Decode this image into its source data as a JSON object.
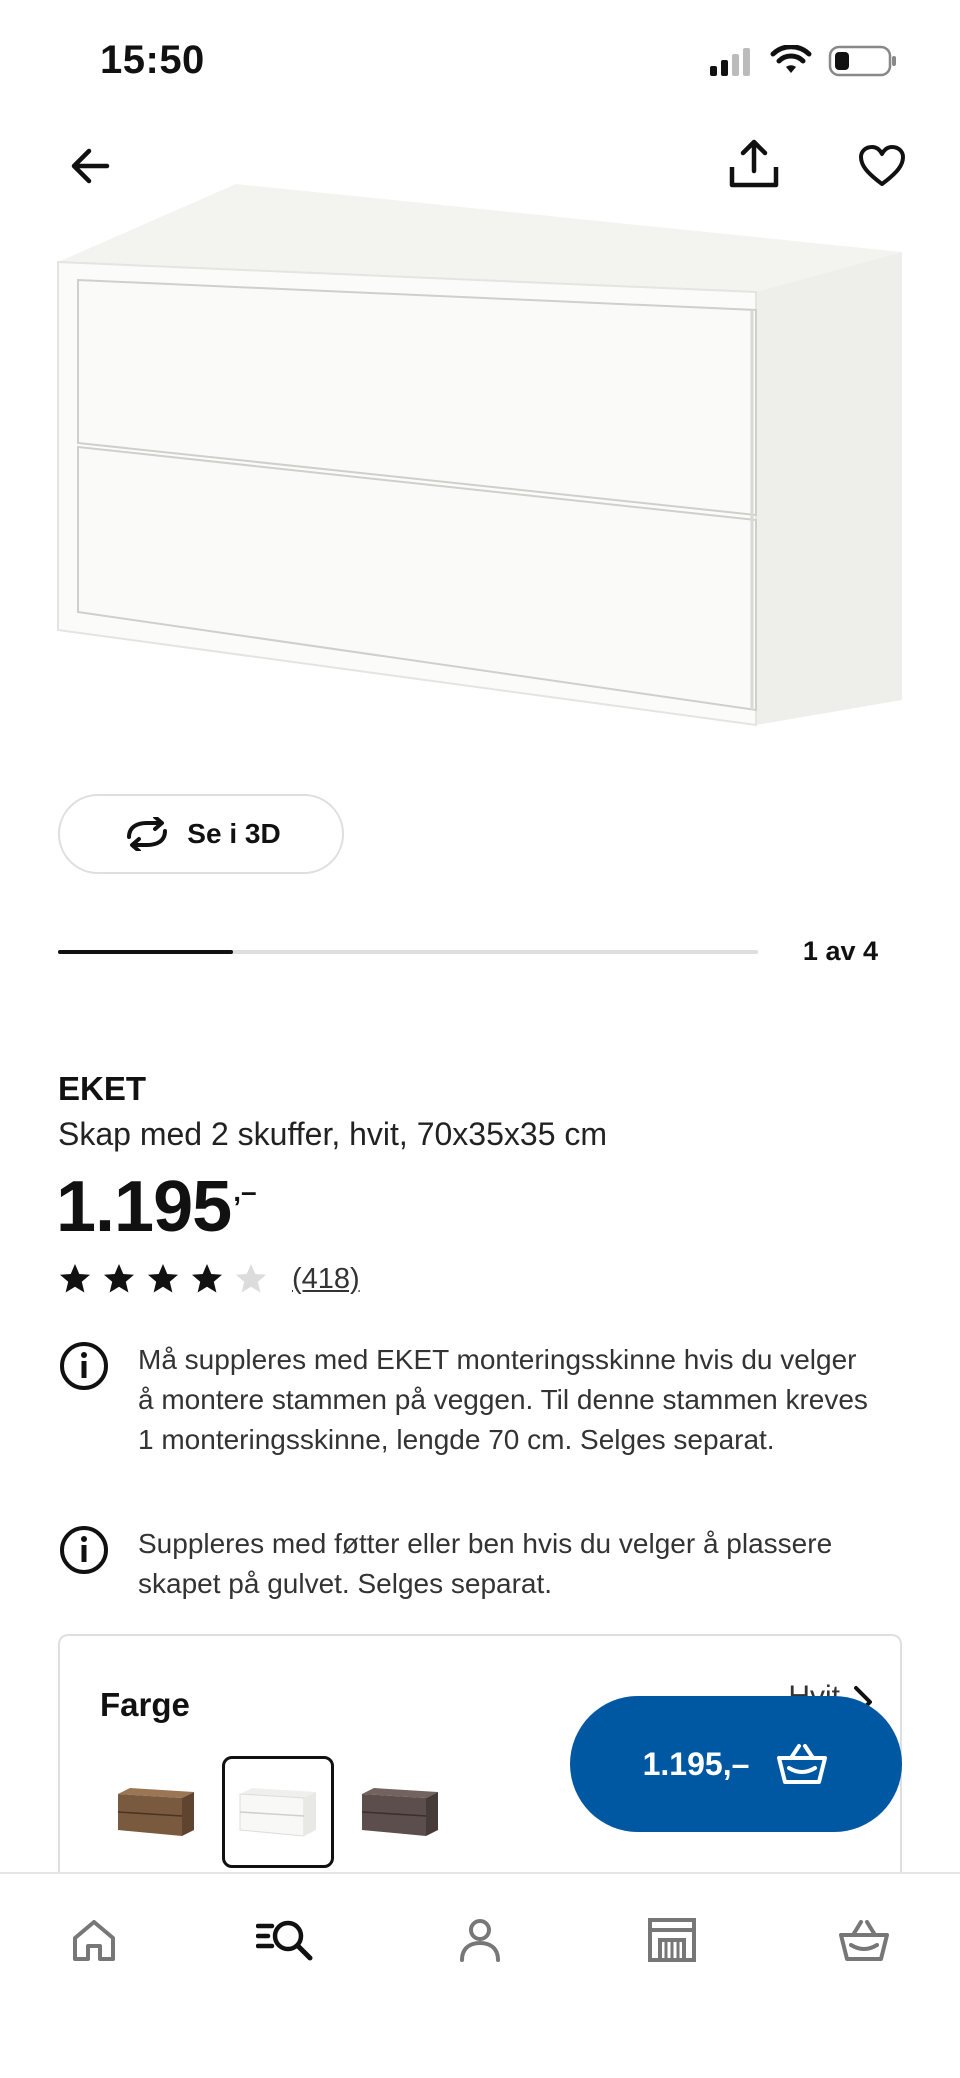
{
  "status_bar": {
    "time": "15:50"
  },
  "gallery": {
    "button_3d_label": "Se i 3D",
    "page_indicator": "1 av 4",
    "progress": 0.25
  },
  "product": {
    "brand": "EKET",
    "description": "Skap med 2 skuffer, hvit, 70x35x35 cm",
    "price": "1.195",
    "price_suffix": ",–",
    "rating": 4,
    "rating_max": 5,
    "review_count": "(418)"
  },
  "notices": [
    {
      "icon": "info-icon",
      "text": "Må suppleres med EKET monteringsskinne hvis du velger å montere stammen på veggen. Til denne stammen kreves 1 monteringsskinne, lengde 70 cm. Selges separat."
    },
    {
      "icon": "info-icon",
      "text": "Suppleres med føtter eller ben hvis du velger å plassere skapet på gulvet. Selges separat."
    }
  ],
  "color_section": {
    "title": "Farge",
    "selected_value": "Hvit",
    "swatches": [
      {
        "name": "walnut",
        "color": "#7a5a3f"
      },
      {
        "name": "white",
        "color": "#f5f5f2",
        "selected": true
      },
      {
        "name": "dark-grey",
        "color": "#5b4e4c"
      }
    ]
  },
  "cart_button": {
    "label": "1.195,–"
  },
  "bottom_nav": [
    {
      "name": "home",
      "icon": "home-icon"
    },
    {
      "name": "search",
      "icon": "search-icon",
      "active": true
    },
    {
      "name": "profile",
      "icon": "person-icon"
    },
    {
      "name": "stores",
      "icon": "store-icon"
    },
    {
      "name": "cart",
      "icon": "basket-icon"
    }
  ],
  "colors": {
    "accent_blue": "#0058a3",
    "text": "#111111",
    "border": "#dfdfdf"
  }
}
